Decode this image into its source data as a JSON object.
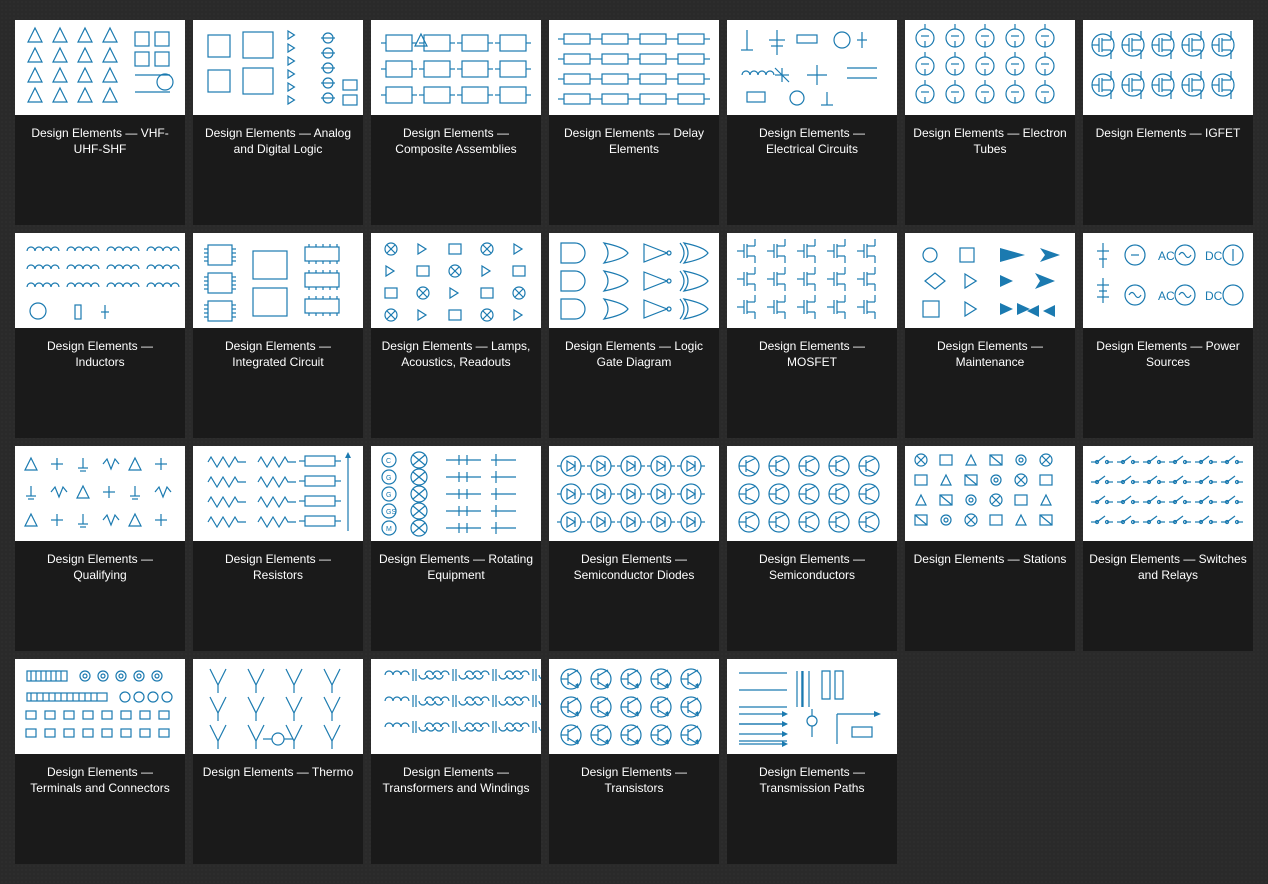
{
  "cards": [
    {
      "id": "vhf-uhf-shf",
      "label": "Design Elements — VHF-UHF-SHF"
    },
    {
      "id": "analog-digital-logic",
      "label": "Design Elements — Analog and Digital Logic"
    },
    {
      "id": "composite-assemblies",
      "label": "Design Elements — Composite Assemblies"
    },
    {
      "id": "delay-elements",
      "label": "Design Elements — Delay Elements"
    },
    {
      "id": "electrical-circuits",
      "label": "Design Elements — Electrical Circuits"
    },
    {
      "id": "electron-tubes",
      "label": "Design Elements — Electron Tubes"
    },
    {
      "id": "igfet",
      "label": "Design Elements — IGFET"
    },
    {
      "id": "inductors",
      "label": "Design Elements — Inductors"
    },
    {
      "id": "integrated-circuit",
      "label": "Design Elements — Integrated Circuit"
    },
    {
      "id": "lamps-acoustics-readouts",
      "label": "Design Elements — Lamps, Acoustics, Readouts"
    },
    {
      "id": "logic-gate-diagram",
      "label": "Design Elements — Logic Gate Diagram"
    },
    {
      "id": "mosfet",
      "label": "Design Elements — MOSFET"
    },
    {
      "id": "maintenance",
      "label": "Design Elements — Maintenance"
    },
    {
      "id": "power-sources",
      "label": "Design Elements — Power Sources"
    },
    {
      "id": "qualifying",
      "label": "Design Elements — Qualifying"
    },
    {
      "id": "resistors",
      "label": "Design Elements — Resistors"
    },
    {
      "id": "rotating-equipment",
      "label": "Design Elements — Rotating Equipment"
    },
    {
      "id": "semiconductor-diodes",
      "label": "Design Elements — Semiconductor Diodes"
    },
    {
      "id": "semiconductors",
      "label": "Design Elements — Semiconductors"
    },
    {
      "id": "stations",
      "label": "Design Elements — Stations"
    },
    {
      "id": "switches-and-relays",
      "label": "Design Elements — Switches and Relays"
    },
    {
      "id": "terminals-and-connectors",
      "label": "Design Elements — Terminals and Connectors"
    },
    {
      "id": "thermo",
      "label": "Design Elements — Thermo"
    },
    {
      "id": "transformers-and-windings",
      "label": "Design Elements — Transformers and Windings"
    },
    {
      "id": "transistors",
      "label": "Design Elements — Transistors"
    },
    {
      "id": "transmission-paths",
      "label": "Design Elements — Transmission Paths"
    }
  ]
}
